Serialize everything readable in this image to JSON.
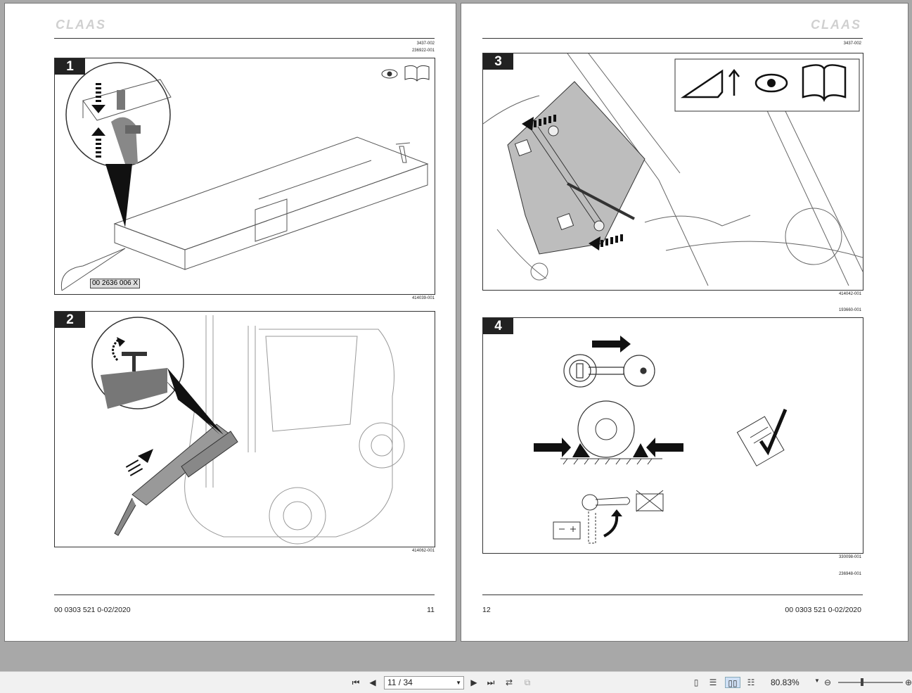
{
  "left_page": {
    "logo": "CLAAS",
    "ref_top_1": "3437-002",
    "ref_top_2": "236922-001",
    "figures": [
      {
        "number": "1",
        "part_label": "00 2636 006 X",
        "caption": "414039-001"
      },
      {
        "number": "2",
        "caption": "414062-001"
      }
    ],
    "footer_doc": "00 0303 521 0-02/2020",
    "footer_page": "11"
  },
  "right_page": {
    "logo": "CLAAS",
    "ref_top_1": "3437-002",
    "figures": [
      {
        "number": "3",
        "caption": "414042-001",
        "sub_caption": "193660-001"
      },
      {
        "number": "4",
        "caption": "330098-001",
        "sub_caption": "236948-001"
      }
    ],
    "footer_page": "12",
    "footer_doc": "00 0303 521 0-02/2020"
  },
  "toolbar": {
    "page_indicator": "11 / 34",
    "zoom": "80.83%",
    "icons": [
      "first-page-icon",
      "previous-page-icon",
      "next-page-icon",
      "last-page-icon",
      "rotate-icon",
      "extract-icon",
      "single-page-icon",
      "continuous-icon",
      "two-page-icon",
      "two-page-continuous-icon",
      "zoom-out-icon",
      "zoom-in-icon"
    ]
  }
}
